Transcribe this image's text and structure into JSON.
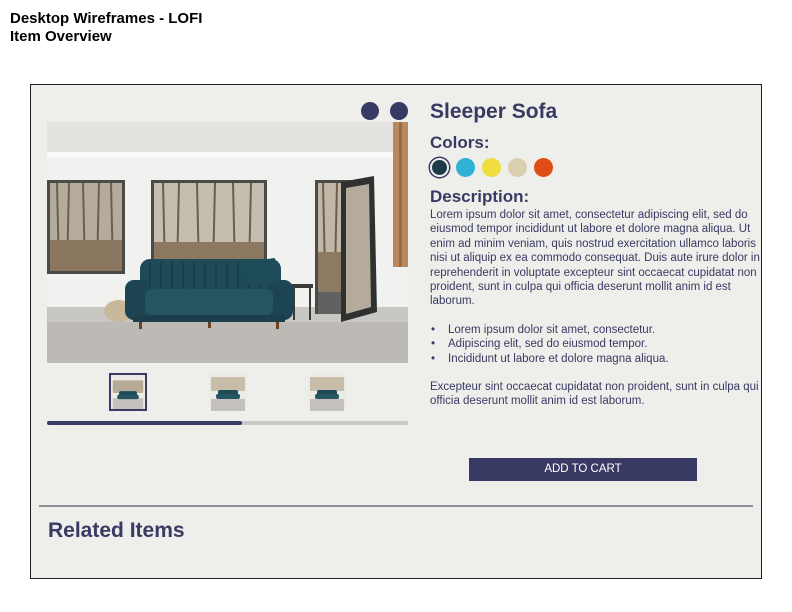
{
  "header": {
    "line1": "Desktop Wireframes - LOFI",
    "line2": "Item Overview"
  },
  "gallery": {
    "image_description": "Teal velvet sleeper sofa in a bright room with windows and an open door",
    "progress_fraction": 0.54,
    "thumbnail_count": 3,
    "top_dots": 2
  },
  "product": {
    "title": "Sleeper Sofa",
    "colors_label": "Colors:",
    "colors": [
      "#1d3b47",
      "#2fb1d6",
      "#efdd3d",
      "#dbcfb2",
      "#e04c17"
    ],
    "description_label": "Description:",
    "description": "Lorem ipsum dolor sit amet, consectetur adipiscing elit, sed do eiusmod tempor incididunt ut labore et dolore magna aliqua. Ut enim ad minim veniam, quis nostrud exercitation ullamco laboris nisi ut aliquip ex ea commodo consequat. Duis aute irure dolor in reprehenderit in voluptate excepteur sint occaecat cupidatat non proident, sunt in culpa qui officia deserunt mollit anim id est laborum.",
    "bullets": [
      "Lorem ipsum dolor sit amet, consectetur.",
      "Adipiscing elit, sed do eiusmod tempor.",
      "Incididunt ut labore et dolore magna aliqua."
    ],
    "footer_text": "Excepteur sint occaecat cupidatat non proident, sunt in culpa qui officia deserunt mollit anim id est laborum.",
    "add_to_cart": "ADD TO CART"
  },
  "related": {
    "title": "Related Items"
  },
  "theme": {
    "accent": "#393a63",
    "panel_bg": "#eeeeeb"
  }
}
